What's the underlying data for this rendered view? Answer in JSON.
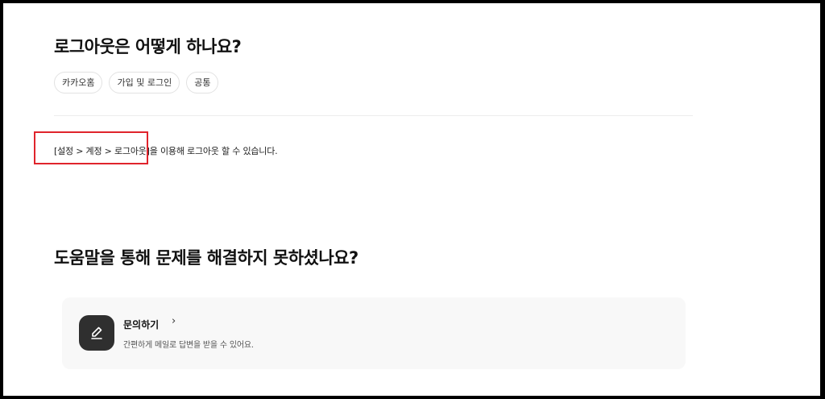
{
  "faq": {
    "title": "로그아웃은 어떻게 하나요?",
    "tags": [
      "카카오홈",
      "가입 및 로그인",
      "공통"
    ],
    "answer": "[설정 > 계정 > 로그아웃]을 이용해 로그아웃 할 수 있습니다."
  },
  "help": {
    "title": "도움말을 통해 문제를 해결하지 못하셨나요?",
    "contact": {
      "label": "문의하기",
      "chevron": "›",
      "description": "간편하게 메일로 답변을 받을 수 있어요.",
      "icon": "pencil-icon"
    }
  },
  "colors": {
    "highlight_border": "#e0242c",
    "card_background": "#f8f8f8",
    "icon_background": "#2f2f2f"
  }
}
